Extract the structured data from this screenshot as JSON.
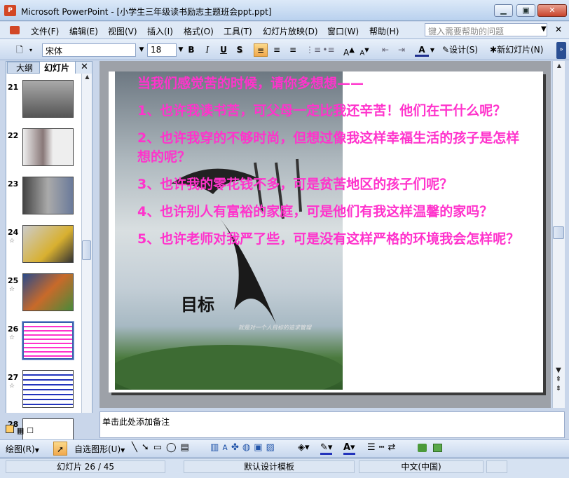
{
  "window": {
    "title": "Microsoft PowerPoint - [小学生三年级读书励志主题班会ppt.ppt]",
    "icon_text": "P",
    "minimize": "▁",
    "maximize": "▣",
    "close": "✕"
  },
  "menu": {
    "items": [
      "文件(F)",
      "编辑(E)",
      "视图(V)",
      "插入(I)",
      "格式(O)",
      "工具(T)",
      "幻灯片放映(D)",
      "窗口(W)",
      "帮助(H)"
    ],
    "help_placeholder": "键入需要帮助的问题"
  },
  "toolbar": {
    "font": "宋体",
    "size": "18",
    "bold": "B",
    "italic": "I",
    "underline": "U",
    "shadow": "S",
    "design": "设计(S)",
    "new_slide": "新幻灯片(N)"
  },
  "pane": {
    "tab_outline": "大纲",
    "tab_slides": "幻灯片",
    "close": "✕",
    "thumbs": [
      {
        "num": "21",
        "star": ""
      },
      {
        "num": "22",
        "star": ""
      },
      {
        "num": "23",
        "star": ""
      },
      {
        "num": "24",
        "star": "☆"
      },
      {
        "num": "25",
        "star": "☆"
      },
      {
        "num": "26",
        "star": "☆"
      },
      {
        "num": "27",
        "star": "☆"
      },
      {
        "num": "28",
        "star": ""
      }
    ],
    "selected": "26"
  },
  "slide": {
    "lines": [
      "当我们感觉苦的时候，请你多想想——",
      "1、也许我读书苦，可父母一定比我还辛苦！他们在干什么呢？",
      "2、也许我穿的不够时尚，但想过像我这样幸福生活的孩子是怎样想的呢？",
      "3、也许我的零花钱不多，可是贫苦地区的孩子们呢？",
      "4、也许别人有富裕的家庭，可是他们有我这样温馨的家吗？",
      "5、也许老师对我严了些，可是没有这样严格的环境我会怎样呢？"
    ],
    "text_color": "#ff33cc",
    "image_caption": "目标",
    "image_subtitle": "就是对一个人目标的追求管理"
  },
  "notes": {
    "placeholder": "单击此处添加备注"
  },
  "drawbar": {
    "draw": "绘图(R)",
    "autoshapes": "自选图形(U)"
  },
  "status": {
    "slide": "幻灯片 26 / 45",
    "template": "默认设计模板",
    "language": "中文(中国)"
  }
}
